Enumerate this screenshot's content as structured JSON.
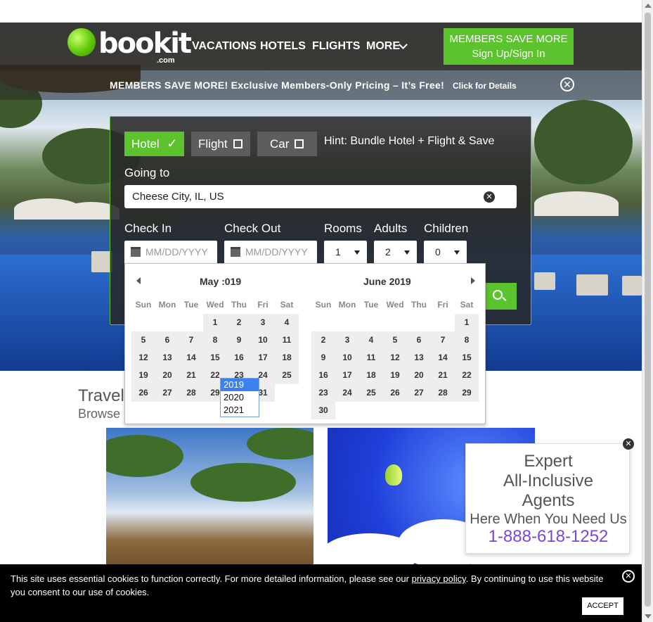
{
  "nav": {
    "logo_text": "bookit",
    "logo_reg": "®",
    "logo_com": ".com",
    "links": [
      "VACATIONS",
      "HOTELS",
      "FLIGHTS",
      "MORE"
    ],
    "members_line1": "MEMBERS SAVE MORE",
    "members_line2": "Sign Up/Sign In"
  },
  "promo": {
    "text": "MEMBERS SAVE MORE! Exclusive Members-Only Pricing – It’s Free!",
    "details": "Click for Details",
    "close": "✕"
  },
  "search": {
    "tabs": [
      "Hotel",
      "Flight",
      "Car"
    ],
    "hotel_check": "✓",
    "hint": "Hint: Bundle Hotel + Flight & Save",
    "going_label": "Going to",
    "going_value": "Cheese City, IL, US",
    "clear": "✕",
    "checkin_label": "Check In",
    "checkout_label": "Check Out",
    "rooms_label": "Rooms",
    "adults_label": "Adults",
    "children_label": "Children",
    "checkin_placeholder": "MM/DD/YYYY",
    "checkout_placeholder": "MM/DD/YYYY",
    "rooms_value": "1",
    "adults_value": "2",
    "children_value": "0"
  },
  "datepicker": {
    "month1": "May",
    "year1_partial": ":019",
    "month2": "June",
    "year2": "2019",
    "weekdays": [
      "Sun",
      "Mon",
      "Tue",
      "Wed",
      "Thu",
      "Fri",
      "Sat"
    ],
    "may_weeks": [
      [
        "",
        "",
        "",
        "1",
        "2",
        "3",
        "4"
      ],
      [
        "5",
        "6",
        "7",
        "8",
        "9",
        "10",
        "11"
      ],
      [
        "12",
        "13",
        "14",
        "15",
        "16",
        "17",
        "18"
      ],
      [
        "19",
        "20",
        "21",
        "22",
        "23",
        "24",
        "25"
      ],
      [
        "26",
        "27",
        "28",
        "29",
        "30",
        "31",
        ""
      ]
    ],
    "june_weeks": [
      [
        "",
        "",
        "",
        "",
        "",
        "",
        "1"
      ],
      [
        "2",
        "3",
        "4",
        "5",
        "6",
        "7",
        "8"
      ],
      [
        "9",
        "10",
        "11",
        "12",
        "13",
        "14",
        "15"
      ],
      [
        "16",
        "17",
        "18",
        "19",
        "20",
        "21",
        "22"
      ],
      [
        "23",
        "24",
        "25",
        "26",
        "27",
        "28",
        "29"
      ],
      [
        "30",
        "",
        "",
        "",
        "",
        "",
        ""
      ]
    ],
    "years": [
      "2019",
      "2020",
      "2021"
    ],
    "selected_year": "2019"
  },
  "content": {
    "travel_title": "Travel",
    "travel_sub": "Browse"
  },
  "expert": {
    "line1": "Expert",
    "line2": "All-Inclusive",
    "line3": "Agents",
    "line4": "Here When You Need Us",
    "phone": "1-888-618-1252",
    "close": "✕"
  },
  "cookie": {
    "text_before": "This site uses essential cookies to function correctly. For more detailed information, please see our",
    "link": "privacy policy",
    "text_after": ". By continuing to use this website you consent to our use of cookies.",
    "accept": "ACCEPT",
    "close": "✕"
  },
  "colors": {
    "brand_green": "#5cc22d",
    "phone_purple": "#7a47d6",
    "year_highlight": "#3b82f0"
  }
}
